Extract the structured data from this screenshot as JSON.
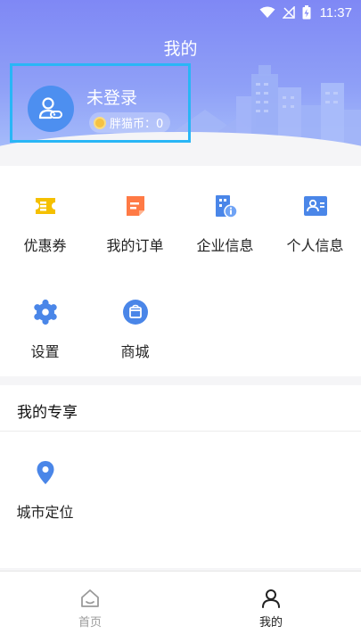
{
  "status_bar": {
    "time": "11:37"
  },
  "header": {
    "title": "我的"
  },
  "profile": {
    "login_status": "未登录",
    "coin_label": "胖猫币：0"
  },
  "menu_items": [
    {
      "label": "优惠券",
      "icon": "coupon-icon"
    },
    {
      "label": "我的订单",
      "icon": "order-icon"
    },
    {
      "label": "企业信息",
      "icon": "company-info-icon"
    },
    {
      "label": "个人信息",
      "icon": "personal-info-icon"
    },
    {
      "label": "设置",
      "icon": "settings-icon"
    },
    {
      "label": "商城",
      "icon": "mall-icon"
    }
  ],
  "exclusive": {
    "title": "我的专享",
    "items": [
      {
        "label": "城市定位",
        "icon": "location-pin-icon"
      }
    ]
  },
  "tabbar": {
    "items": [
      {
        "label": "首页",
        "icon": "home-icon",
        "active": false
      },
      {
        "label": "我的",
        "icon": "user-icon",
        "active": true
      }
    ]
  },
  "colors": {
    "header_gradient_top": "#7f88f5",
    "header_gradient_bottom": "#a9c0fb",
    "highlight_border": "#29b6f6",
    "avatar_bg": "#4d8ff0",
    "coupon": "#f5c000",
    "order": "#ff7a45",
    "blue_icon": "#4a86e8"
  }
}
